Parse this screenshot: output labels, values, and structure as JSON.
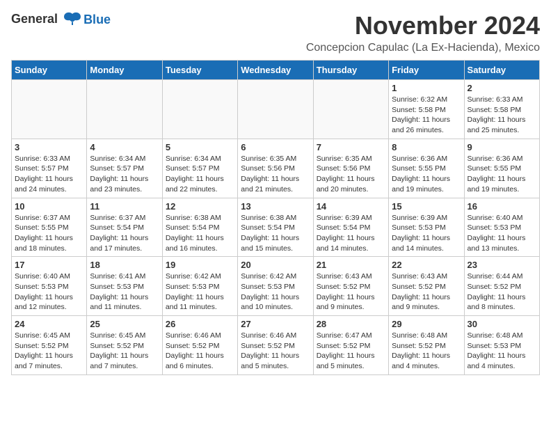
{
  "logo": {
    "line1": "General",
    "line2": "Blue"
  },
  "title": "November 2024",
  "location": "Concepcion Capulac (La Ex-Hacienda), Mexico",
  "headers": [
    "Sunday",
    "Monday",
    "Tuesday",
    "Wednesday",
    "Thursday",
    "Friday",
    "Saturday"
  ],
  "weeks": [
    [
      {
        "day": "",
        "info": ""
      },
      {
        "day": "",
        "info": ""
      },
      {
        "day": "",
        "info": ""
      },
      {
        "day": "",
        "info": ""
      },
      {
        "day": "",
        "info": ""
      },
      {
        "day": "1",
        "info": "Sunrise: 6:32 AM\nSunset: 5:58 PM\nDaylight: 11 hours and 26 minutes."
      },
      {
        "day": "2",
        "info": "Sunrise: 6:33 AM\nSunset: 5:58 PM\nDaylight: 11 hours and 25 minutes."
      }
    ],
    [
      {
        "day": "3",
        "info": "Sunrise: 6:33 AM\nSunset: 5:57 PM\nDaylight: 11 hours and 24 minutes."
      },
      {
        "day": "4",
        "info": "Sunrise: 6:34 AM\nSunset: 5:57 PM\nDaylight: 11 hours and 23 minutes."
      },
      {
        "day": "5",
        "info": "Sunrise: 6:34 AM\nSunset: 5:57 PM\nDaylight: 11 hours and 22 minutes."
      },
      {
        "day": "6",
        "info": "Sunrise: 6:35 AM\nSunset: 5:56 PM\nDaylight: 11 hours and 21 minutes."
      },
      {
        "day": "7",
        "info": "Sunrise: 6:35 AM\nSunset: 5:56 PM\nDaylight: 11 hours and 20 minutes."
      },
      {
        "day": "8",
        "info": "Sunrise: 6:36 AM\nSunset: 5:55 PM\nDaylight: 11 hours and 19 minutes."
      },
      {
        "day": "9",
        "info": "Sunrise: 6:36 AM\nSunset: 5:55 PM\nDaylight: 11 hours and 19 minutes."
      }
    ],
    [
      {
        "day": "10",
        "info": "Sunrise: 6:37 AM\nSunset: 5:55 PM\nDaylight: 11 hours and 18 minutes."
      },
      {
        "day": "11",
        "info": "Sunrise: 6:37 AM\nSunset: 5:54 PM\nDaylight: 11 hours and 17 minutes."
      },
      {
        "day": "12",
        "info": "Sunrise: 6:38 AM\nSunset: 5:54 PM\nDaylight: 11 hours and 16 minutes."
      },
      {
        "day": "13",
        "info": "Sunrise: 6:38 AM\nSunset: 5:54 PM\nDaylight: 11 hours and 15 minutes."
      },
      {
        "day": "14",
        "info": "Sunrise: 6:39 AM\nSunset: 5:54 PM\nDaylight: 11 hours and 14 minutes."
      },
      {
        "day": "15",
        "info": "Sunrise: 6:39 AM\nSunset: 5:53 PM\nDaylight: 11 hours and 14 minutes."
      },
      {
        "day": "16",
        "info": "Sunrise: 6:40 AM\nSunset: 5:53 PM\nDaylight: 11 hours and 13 minutes."
      }
    ],
    [
      {
        "day": "17",
        "info": "Sunrise: 6:40 AM\nSunset: 5:53 PM\nDaylight: 11 hours and 12 minutes."
      },
      {
        "day": "18",
        "info": "Sunrise: 6:41 AM\nSunset: 5:53 PM\nDaylight: 11 hours and 11 minutes."
      },
      {
        "day": "19",
        "info": "Sunrise: 6:42 AM\nSunset: 5:53 PM\nDaylight: 11 hours and 11 minutes."
      },
      {
        "day": "20",
        "info": "Sunrise: 6:42 AM\nSunset: 5:53 PM\nDaylight: 11 hours and 10 minutes."
      },
      {
        "day": "21",
        "info": "Sunrise: 6:43 AM\nSunset: 5:52 PM\nDaylight: 11 hours and 9 minutes."
      },
      {
        "day": "22",
        "info": "Sunrise: 6:43 AM\nSunset: 5:52 PM\nDaylight: 11 hours and 9 minutes."
      },
      {
        "day": "23",
        "info": "Sunrise: 6:44 AM\nSunset: 5:52 PM\nDaylight: 11 hours and 8 minutes."
      }
    ],
    [
      {
        "day": "24",
        "info": "Sunrise: 6:45 AM\nSunset: 5:52 PM\nDaylight: 11 hours and 7 minutes."
      },
      {
        "day": "25",
        "info": "Sunrise: 6:45 AM\nSunset: 5:52 PM\nDaylight: 11 hours and 7 minutes."
      },
      {
        "day": "26",
        "info": "Sunrise: 6:46 AM\nSunset: 5:52 PM\nDaylight: 11 hours and 6 minutes."
      },
      {
        "day": "27",
        "info": "Sunrise: 6:46 AM\nSunset: 5:52 PM\nDaylight: 11 hours and 5 minutes."
      },
      {
        "day": "28",
        "info": "Sunrise: 6:47 AM\nSunset: 5:52 PM\nDaylight: 11 hours and 5 minutes."
      },
      {
        "day": "29",
        "info": "Sunrise: 6:48 AM\nSunset: 5:52 PM\nDaylight: 11 hours and 4 minutes."
      },
      {
        "day": "30",
        "info": "Sunrise: 6:48 AM\nSunset: 5:53 PM\nDaylight: 11 hours and 4 minutes."
      }
    ]
  ]
}
